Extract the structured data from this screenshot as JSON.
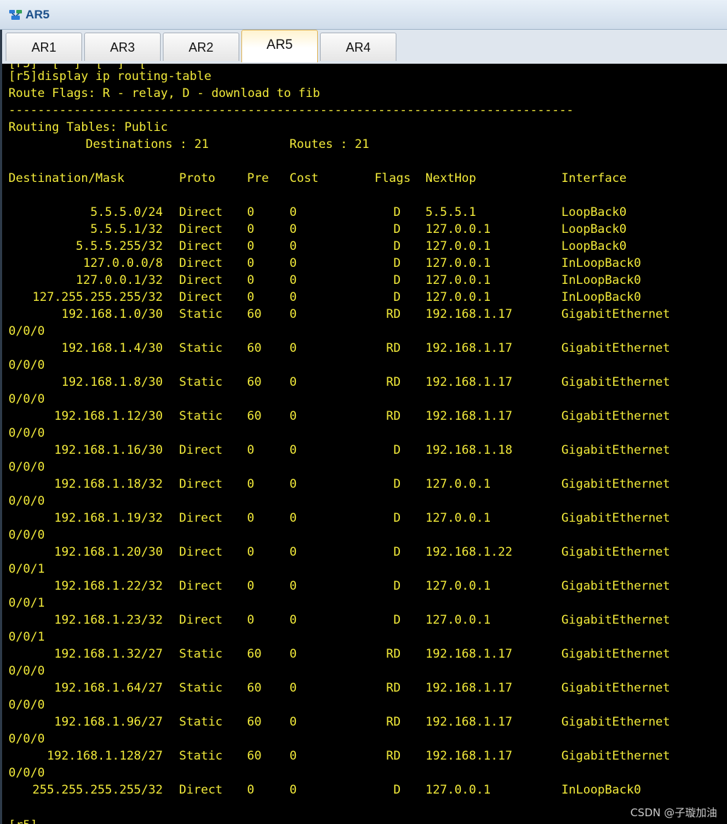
{
  "window": {
    "title": "AR5",
    "icon": "router-icon"
  },
  "tabs": [
    {
      "label": "AR1",
      "active": false
    },
    {
      "label": "AR3",
      "active": false
    },
    {
      "label": "AR2",
      "active": false
    },
    {
      "label": "AR5",
      "active": true
    },
    {
      "label": "AR4",
      "active": false
    }
  ],
  "terminal": {
    "colors": {
      "background": "#000000",
      "text": "#f2ea3a"
    },
    "partial_top_line": "[r5]  [  ]  [  ]  [",
    "command": "[r5]display ip routing-table",
    "flags_line": "Route Flags: R - relay, D - download to fib",
    "separator": "------------------------------------------------------------------------------",
    "tables_line": "Routing Tables: Public",
    "destinations_label": "Destinations : 21",
    "routes_label": "Routes : 21",
    "headers": {
      "dest": "Destination/Mask",
      "proto": "Proto",
      "pre": "Pre",
      "cost": "Cost",
      "flags": "Flags",
      "nexthop": "NextHop",
      "iface": "Interface"
    },
    "routes": [
      {
        "dest": "5.5.5.0/24",
        "proto": "Direct",
        "pre": "0",
        "cost": "0",
        "flags": "D",
        "nexthop": "5.5.5.1",
        "iface": "LoopBack0",
        "wrap": ""
      },
      {
        "dest": "5.5.5.1/32",
        "proto": "Direct",
        "pre": "0",
        "cost": "0",
        "flags": "D",
        "nexthop": "127.0.0.1",
        "iface": "LoopBack0",
        "wrap": ""
      },
      {
        "dest": "5.5.5.255/32",
        "proto": "Direct",
        "pre": "0",
        "cost": "0",
        "flags": "D",
        "nexthop": "127.0.0.1",
        "iface": "LoopBack0",
        "wrap": ""
      },
      {
        "dest": "127.0.0.0/8",
        "proto": "Direct",
        "pre": "0",
        "cost": "0",
        "flags": "D",
        "nexthop": "127.0.0.1",
        "iface": "InLoopBack0",
        "wrap": ""
      },
      {
        "dest": "127.0.0.1/32",
        "proto": "Direct",
        "pre": "0",
        "cost": "0",
        "flags": "D",
        "nexthop": "127.0.0.1",
        "iface": "InLoopBack0",
        "wrap": ""
      },
      {
        "dest": "127.255.255.255/32",
        "proto": "Direct",
        "pre": "0",
        "cost": "0",
        "flags": "D",
        "nexthop": "127.0.0.1",
        "iface": "InLoopBack0",
        "wrap": ""
      },
      {
        "dest": "192.168.1.0/30",
        "proto": "Static",
        "pre": "60",
        "cost": "0",
        "flags": "RD",
        "nexthop": "192.168.1.17",
        "iface": "GigabitEthernet",
        "wrap": "0/0/0"
      },
      {
        "dest": "192.168.1.4/30",
        "proto": "Static",
        "pre": "60",
        "cost": "0",
        "flags": "RD",
        "nexthop": "192.168.1.17",
        "iface": "GigabitEthernet",
        "wrap": "0/0/0"
      },
      {
        "dest": "192.168.1.8/30",
        "proto": "Static",
        "pre": "60",
        "cost": "0",
        "flags": "RD",
        "nexthop": "192.168.1.17",
        "iface": "GigabitEthernet",
        "wrap": "0/0/0"
      },
      {
        "dest": "192.168.1.12/30",
        "proto": "Static",
        "pre": "60",
        "cost": "0",
        "flags": "RD",
        "nexthop": "192.168.1.17",
        "iface": "GigabitEthernet",
        "wrap": "0/0/0"
      },
      {
        "dest": "192.168.1.16/30",
        "proto": "Direct",
        "pre": "0",
        "cost": "0",
        "flags": "D",
        "nexthop": "192.168.1.18",
        "iface": "GigabitEthernet",
        "wrap": "0/0/0"
      },
      {
        "dest": "192.168.1.18/32",
        "proto": "Direct",
        "pre": "0",
        "cost": "0",
        "flags": "D",
        "nexthop": "127.0.0.1",
        "iface": "GigabitEthernet",
        "wrap": "0/0/0"
      },
      {
        "dest": "192.168.1.19/32",
        "proto": "Direct",
        "pre": "0",
        "cost": "0",
        "flags": "D",
        "nexthop": "127.0.0.1",
        "iface": "GigabitEthernet",
        "wrap": "0/0/0"
      },
      {
        "dest": "192.168.1.20/30",
        "proto": "Direct",
        "pre": "0",
        "cost": "0",
        "flags": "D",
        "nexthop": "192.168.1.22",
        "iface": "GigabitEthernet",
        "wrap": "0/0/1"
      },
      {
        "dest": "192.168.1.22/32",
        "proto": "Direct",
        "pre": "0",
        "cost": "0",
        "flags": "D",
        "nexthop": "127.0.0.1",
        "iface": "GigabitEthernet",
        "wrap": "0/0/1"
      },
      {
        "dest": "192.168.1.23/32",
        "proto": "Direct",
        "pre": "0",
        "cost": "0",
        "flags": "D",
        "nexthop": "127.0.0.1",
        "iface": "GigabitEthernet",
        "wrap": "0/0/1"
      },
      {
        "dest": "192.168.1.32/27",
        "proto": "Static",
        "pre": "60",
        "cost": "0",
        "flags": "RD",
        "nexthop": "192.168.1.17",
        "iface": "GigabitEthernet",
        "wrap": "0/0/0"
      },
      {
        "dest": "192.168.1.64/27",
        "proto": "Static",
        "pre": "60",
        "cost": "0",
        "flags": "RD",
        "nexthop": "192.168.1.17",
        "iface": "GigabitEthernet",
        "wrap": "0/0/0"
      },
      {
        "dest": "192.168.1.96/27",
        "proto": "Static",
        "pre": "60",
        "cost": "0",
        "flags": "RD",
        "nexthop": "192.168.1.17",
        "iface": "GigabitEthernet",
        "wrap": "0/0/0"
      },
      {
        "dest": "192.168.1.128/27",
        "proto": "Static",
        "pre": "60",
        "cost": "0",
        "flags": "RD",
        "nexthop": "192.168.1.17",
        "iface": "GigabitEthernet",
        "wrap": "0/0/0"
      },
      {
        "dest": "255.255.255.255/32",
        "proto": "Direct",
        "pre": "0",
        "cost": "0",
        "flags": "D",
        "nexthop": "127.0.0.1",
        "iface": "InLoopBack0",
        "wrap": ""
      }
    ],
    "prompt_partial": "[r5]"
  },
  "watermark": "CSDN @子璇加油"
}
